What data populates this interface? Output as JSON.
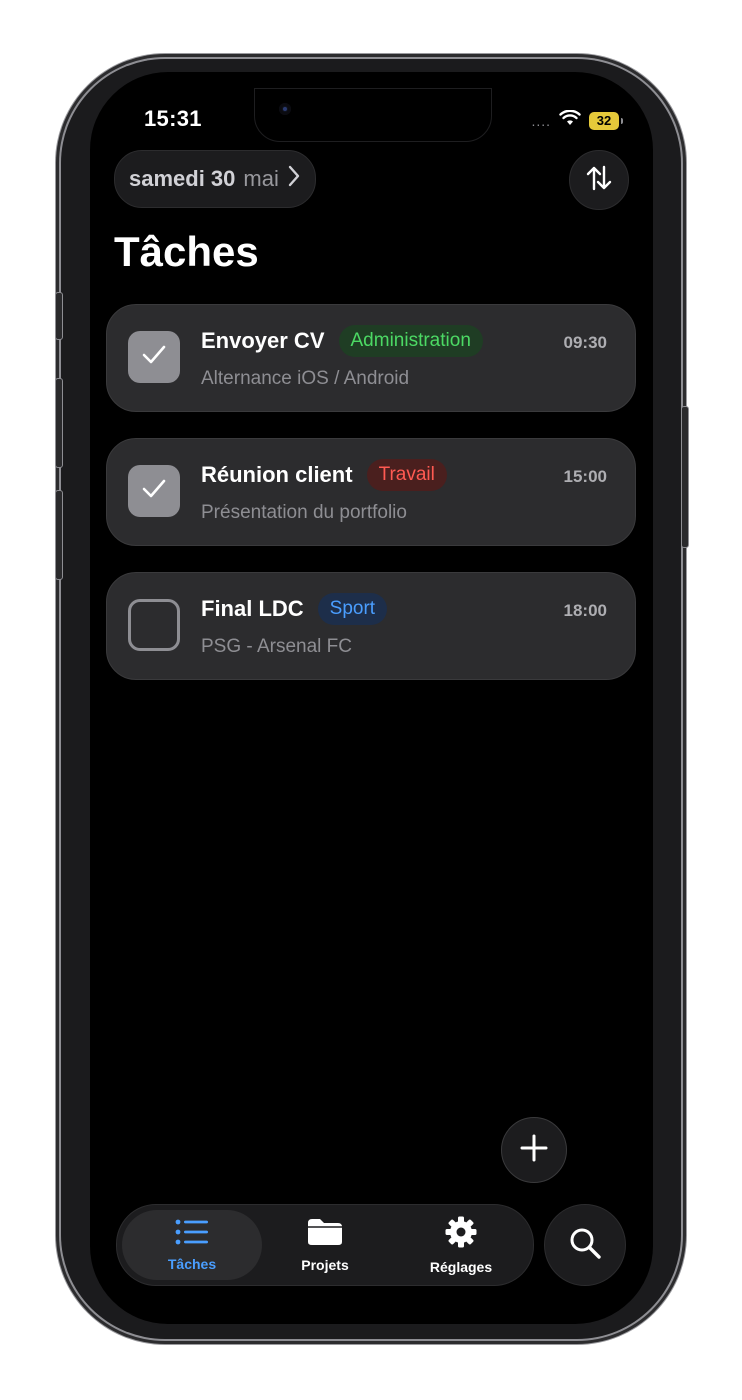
{
  "status_bar": {
    "time": "15:31",
    "signal_dots": "....",
    "battery_level": "32",
    "battery_color": "#e5c93a"
  },
  "header": {
    "date_bold": "samedi 30",
    "date_month": "mai",
    "title": "Tâches"
  },
  "tasks": [
    {
      "title": "Envoyer CV",
      "tag": "Administration",
      "tag_color": "#4cd964",
      "tag_bg": "#1f3d24",
      "subtitle": "Alternance iOS / Android",
      "time": "09:30",
      "completed": true
    },
    {
      "title": "Réunion client",
      "tag": "Travail",
      "tag_color": "#ff5a52",
      "tag_bg": "#4a1f1e",
      "subtitle": "Présentation du portfolio",
      "time": "15:00",
      "completed": true
    },
    {
      "title": "Final LDC",
      "tag": "Sport",
      "tag_color": "#4a9eff",
      "tag_bg": "#1d2e4a",
      "subtitle": "PSG - Arsenal FC",
      "time": "18:00",
      "completed": false
    }
  ],
  "tab_bar": {
    "tasks_label": "Tâches",
    "projects_label": "Projets",
    "settings_label": "Réglages",
    "active_color": "#4a9eff"
  },
  "icons": [
    "sort-icon",
    "chevron-right-icon",
    "checkmark-icon",
    "plus-icon",
    "list-icon",
    "folder-icon",
    "gear-icon",
    "search-icon",
    "wifi-icon"
  ]
}
